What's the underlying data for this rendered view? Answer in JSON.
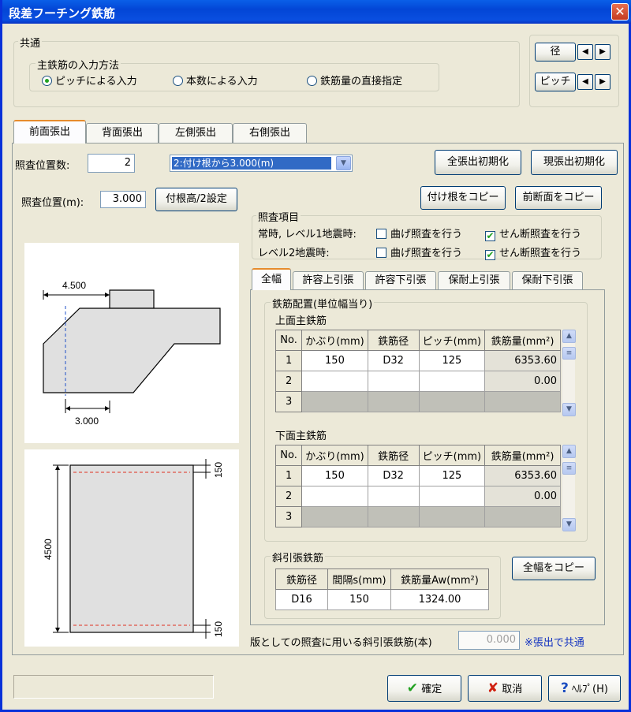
{
  "window": {
    "title": "段差フーチング鉄筋"
  },
  "common": {
    "legend": "共通",
    "input_method_legend": "主鉄筋の入力方法",
    "options": [
      "ピッチによる入力",
      "本数による入力",
      "鉄筋量の直接指定"
    ],
    "selected_index": 0,
    "diameter_label": "径",
    "pitch_label": "ピッチ"
  },
  "main_tabs": [
    "前面張出",
    "背面張出",
    "左側張出",
    "右側張出"
  ],
  "active_main_tab": 0,
  "check_positions": {
    "label": "照査位置数:",
    "value": "2"
  },
  "position_select": {
    "value": "2:付け根から3.000(m)"
  },
  "buttons": {
    "all_init": "全張出初期化",
    "current_init": "現張出初期化",
    "copy_root": "付け根をコピー",
    "copy_front": "前断面をコピー",
    "root_height": "付根高/2設定",
    "copy_full_width": "全幅をコピー",
    "ok": "確定",
    "cancel": "取消",
    "help": "ﾍﾙﾌﾟ(H)"
  },
  "check_position_m": {
    "label": "照査位置(m):",
    "value": "3.000"
  },
  "check_items": {
    "legend": "照査項目",
    "row1_label": "常時, レベル1地震時:",
    "row2_label": "レベル2地震時:",
    "bending_label": "曲げ照査を行う",
    "shear_label": "せん断照査を行う",
    "row1_bending": false,
    "row1_shear": true,
    "row2_bending": false,
    "row2_shear": true
  },
  "sub_tabs": [
    "全幅",
    "許容上引張",
    "許容下引張",
    "保耐上引張",
    "保耐下引張"
  ],
  "active_sub_tab": 0,
  "rebar_layout": {
    "legend": "鉄筋配置(単位幅当り)",
    "columns": [
      "No.",
      "かぶり(mm)",
      "鉄筋径",
      "ピッチ(mm)",
      "鉄筋量(mm²)"
    ],
    "top": {
      "title": "上面主鉄筋",
      "rows": [
        [
          "1",
          "150",
          "D32",
          "125",
          "6353.60"
        ],
        [
          "2",
          "",
          "",
          "",
          "0.00"
        ],
        [
          "3",
          "",
          "",
          "",
          ""
        ]
      ]
    },
    "bottom": {
      "title": "下面主鉄筋",
      "rows": [
        [
          "1",
          "150",
          "D32",
          "125",
          "6353.60"
        ],
        [
          "2",
          "",
          "",
          "",
          "0.00"
        ],
        [
          "3",
          "",
          "",
          "",
          ""
        ]
      ]
    }
  },
  "diagonal": {
    "legend": "斜引張鉄筋",
    "columns": [
      "鉄筋径",
      "間隔s(mm)",
      "鉄筋量Aw(mm²)"
    ],
    "row": [
      "D16",
      "150",
      "1324.00"
    ]
  },
  "slab_check": {
    "label": "版としての照査に用いる斜引張鉄筋(本)",
    "value": "0.000",
    "note": "※張出で共通"
  },
  "diagram_top": {
    "dim_top": "4.500",
    "dim_bottom": "3.000"
  },
  "diagram_bottom": {
    "height": "4500",
    "cover_top": "150",
    "cover_bottom": "150"
  },
  "colors": {
    "dashed_line": "#2050c8",
    "rebar_line": "#e03020"
  }
}
